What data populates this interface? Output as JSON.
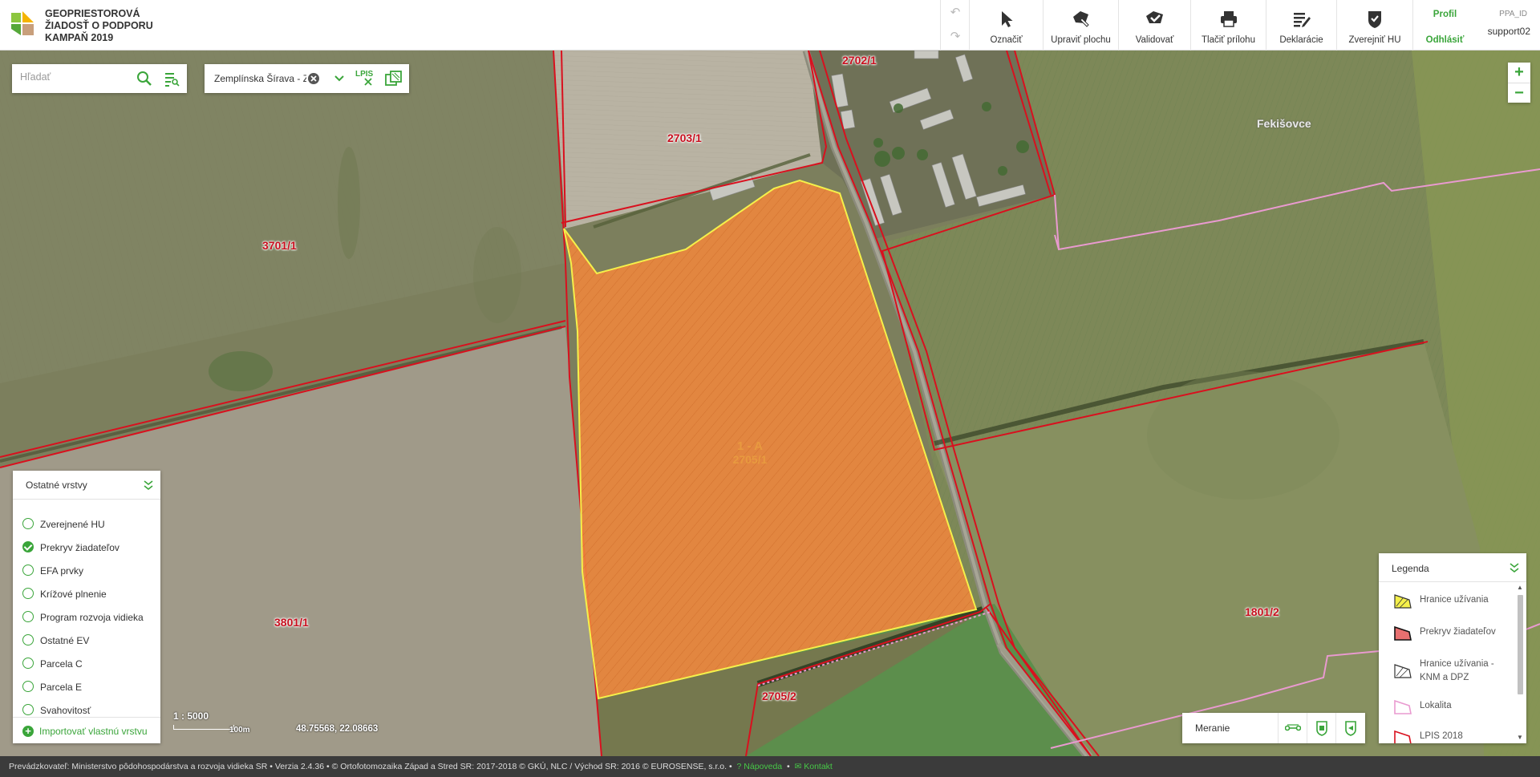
{
  "app": {
    "title_lines": [
      "GEOPRIESTOROVÁ",
      "ŽIADOSŤ O PODPORU",
      "KAMPAŇ 2019"
    ]
  },
  "toolbar": {
    "items": [
      {
        "label": "Označiť",
        "icon": "cursor-arrow-icon"
      },
      {
        "label": "Upraviť plochu",
        "icon": "edit-polygon-icon"
      },
      {
        "label": "Validovať",
        "icon": "validate-polygon-icon"
      },
      {
        "label": "Tlačiť prílohu",
        "icon": "printer-icon"
      },
      {
        "label": "Deklarácie",
        "icon": "declarations-list-icon"
      },
      {
        "label": "Zverejniť HU",
        "icon": "publish-shield-icon"
      }
    ],
    "undo_icon": "undo-icon",
    "redo_icon": "redo-icon"
  },
  "user": {
    "profile_label": "Profil",
    "logout_label": "Odhlásiť",
    "id_label": "PPA_ID",
    "username": "support02"
  },
  "search": {
    "placeholder": "Hľadať"
  },
  "campaign": {
    "value": "Zemplínska Šírava - Z",
    "lpis_label": "LPIS"
  },
  "zoom": {
    "in": "+",
    "out": "−"
  },
  "map": {
    "parcels": [
      {
        "id": "2703/1"
      },
      {
        "id": "2702/1"
      },
      {
        "id": "3701/1"
      },
      {
        "id": "3801/1"
      },
      {
        "id": "2705/2"
      },
      {
        "id": "1801/2"
      }
    ],
    "place_name": "Fekišovce",
    "selected_block": {
      "code": "1 - A",
      "parcel": "2705/1"
    },
    "colors": {
      "boundary": "#d9101e",
      "selected_fill": "#f0883c",
      "selected_outline": "#f5f04a",
      "locality": "#e99ad0"
    }
  },
  "layers": {
    "title": "Ostatné vrstvy",
    "items": [
      {
        "label": "Zverejnené HU",
        "checked": false
      },
      {
        "label": "Prekryv žiadateľov",
        "checked": true
      },
      {
        "label": "EFA prvky",
        "checked": false
      },
      {
        "label": "Krížové plnenie",
        "checked": false
      },
      {
        "label": "Program rozvoja vidieka",
        "checked": false
      },
      {
        "label": "Ostatné EV",
        "checked": false
      },
      {
        "label": "Parcela C",
        "checked": false
      },
      {
        "label": "Parcela E",
        "checked": false
      },
      {
        "label": "Svahovitosť",
        "checked": false
      }
    ],
    "import_label": "Importovať vlastnú vrstvu"
  },
  "scale": {
    "ratio": "1 : 5000",
    "bar_label": "100m"
  },
  "coordinates": "48.75568, 22.08663",
  "measure": {
    "label": "Meranie"
  },
  "legend": {
    "title": "Legenda",
    "items": [
      {
        "label": "Hranice užívania"
      },
      {
        "label": "Prekryv žiadateľov"
      },
      {
        "label": "Hranice užívania - KNM a DPZ"
      },
      {
        "label": "Lokalita"
      },
      {
        "label": "LPIS 2018"
      }
    ]
  },
  "footer": {
    "text": "Prevádzkovateľ: Ministerstvo pôdohospodárstva a rozvoja vidieka SR • Verzia 2.4.36 • © Ortofotomozaika Západ a Stred SR: 2017-2018 © GKÚ, NLC / Východ SR: 2016 © EUROSENSE, s.r.o. •",
    "help": "Nápoveda",
    "contact": "Kontakt"
  }
}
